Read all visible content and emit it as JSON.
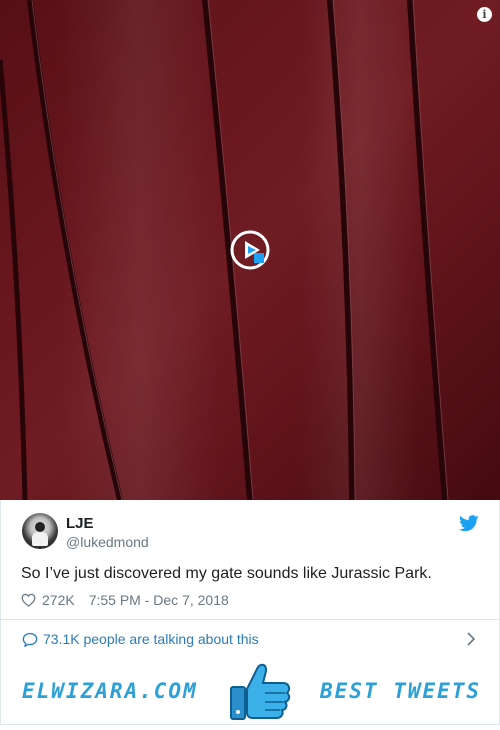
{
  "video": {
    "info_icon": "i",
    "play_icon": "play-circle-icon"
  },
  "tweet": {
    "display_name": "LJE",
    "handle": "@lukedmond",
    "text": "So I’ve just discovered my gate sounds like Jurassic Park.",
    "likes": "272K",
    "timestamp": "7:55 PM - Dec 7, 2018"
  },
  "conversation": {
    "label": "73.1K people are talking about this"
  },
  "banner": {
    "site": "ELWIZARA.COM",
    "tag": "BEST TWEETS"
  },
  "colors": {
    "twitter_blue": "#1da1f2",
    "link_blue": "#2b7bb9",
    "banner_blue": "#2ea0d8",
    "video_red": "#741a22"
  }
}
